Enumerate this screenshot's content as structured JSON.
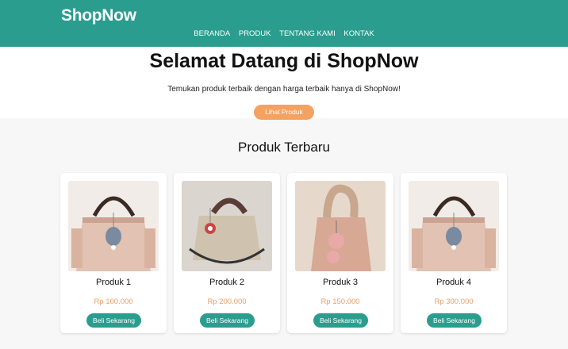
{
  "header": {
    "logo": "ShopNow",
    "nav": [
      "BERANDA",
      "PRODUK",
      "TENTANG KAMI",
      "KONTAK"
    ]
  },
  "hero": {
    "title": "Selamat Datang di ShopNow",
    "subtitle": "Temukan produk terbaik dengan harga terbaik hanya di ShopNow!",
    "cta": "Lihat Produk"
  },
  "products_section": {
    "title": "Produk Terbaru",
    "items": [
      {
        "name": "Produk 1",
        "price": "Rp 100.000",
        "button": "Beli Sekarang",
        "image": "handbag-with-cat-charm"
      },
      {
        "name": "Produk 2",
        "price": "Rp 200.000",
        "button": "Beli Sekarang",
        "image": "handbag-brown-handle"
      },
      {
        "name": "Produk 3",
        "price": "Rp 150.000",
        "button": "Beli Sekarang",
        "image": "handbag-braided-handle"
      },
      {
        "name": "Produk 4",
        "price": "Rp 300.000",
        "button": "Beli Sekarang",
        "image": "handbag-with-cat-charm"
      }
    ]
  },
  "colors": {
    "primary": "#2a9d8f",
    "accent": "#f4a261",
    "price": "#e9a06b"
  }
}
